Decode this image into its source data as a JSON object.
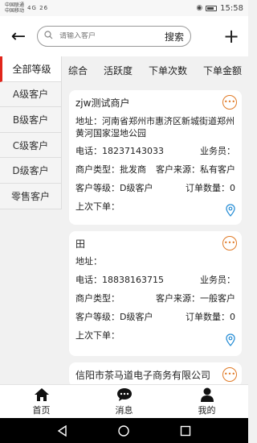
{
  "status_bar": {
    "carrier1": "中国联通",
    "carrier2": "中国移动",
    "network": "4G 26",
    "time": "15:58"
  },
  "header": {
    "search_placeholder": "请输入客户",
    "search_label": "搜索",
    "add_label": "+"
  },
  "sidebar": {
    "items": [
      {
        "label": "全部等级",
        "active": true
      },
      {
        "label": "A级客户"
      },
      {
        "label": "B级客户"
      },
      {
        "label": "C级客户"
      },
      {
        "label": "D级客户"
      },
      {
        "label": "零售客户"
      }
    ]
  },
  "sort_tabs": [
    "综合",
    "活跃度",
    "下单次数",
    "下单金额"
  ],
  "customers": [
    {
      "name": "zjw测试商户",
      "address": "地址：河南省郑州市惠济区新城街道郑州黄河国家湿地公园",
      "phone": "电话：18237143033",
      "salesman": "业务员：",
      "type": "商户类型：批发商",
      "source": "客户来源：私有客户",
      "level": "客户等级：D级客户",
      "order_count": "订单数量：0",
      "last_order": "上次下单："
    },
    {
      "name": "田",
      "address": "地址：",
      "phone": "电话：18838163715",
      "salesman": "业务员：",
      "type": "商户类型：",
      "source": "客户来源：一般客户",
      "level": "客户等级：D级客户",
      "order_count": "订单数量：0",
      "last_order": "上次下单："
    },
    {
      "name": "信阳市茶马道电子商务有限公司"
    }
  ],
  "bottom_nav": [
    {
      "label": "首页",
      "icon": "home-icon"
    },
    {
      "label": "消息",
      "icon": "message-icon"
    },
    {
      "label": "我的",
      "icon": "profile-icon"
    }
  ],
  "colors": {
    "accent_orange": "#e07a26",
    "location_blue": "#2a8fd6",
    "active_red": "#e1251b"
  }
}
